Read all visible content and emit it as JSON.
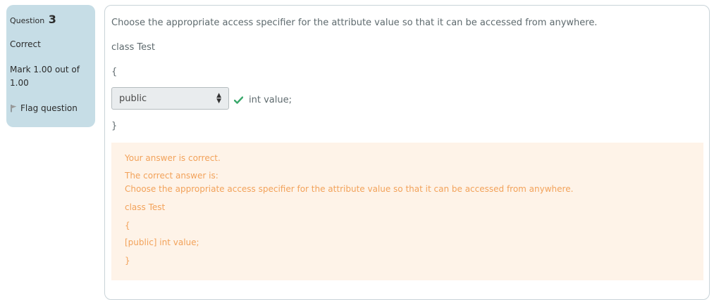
{
  "info": {
    "question_label": "Question",
    "question_number": "3",
    "state": "Correct",
    "grade": "Mark 1.00 out of 1.00",
    "flag_label": "Flag question",
    "flag_icon": "flag-icon"
  },
  "question": {
    "text": "Choose the appropriate access specifier for the attribute value so that it can be accessed from anywhere.",
    "code_line1": "class Test",
    "open_brace": "{",
    "select_value": "public",
    "after_select": "int value;",
    "close_brace": "}",
    "correct_icon": "check-icon",
    "correct_color": "#3aa86b"
  },
  "feedback": {
    "line1": "Your answer is correct.",
    "line2": "The correct answer is:",
    "line3": "Choose the appropriate access specifier for the attribute value so that it can be accessed from anywhere.",
    "line4": "class Test",
    "line5": "{",
    "line6": "[public] int value;",
    "line7": "}",
    "background": "#fef3e8",
    "text_color": "#f2a25a"
  }
}
